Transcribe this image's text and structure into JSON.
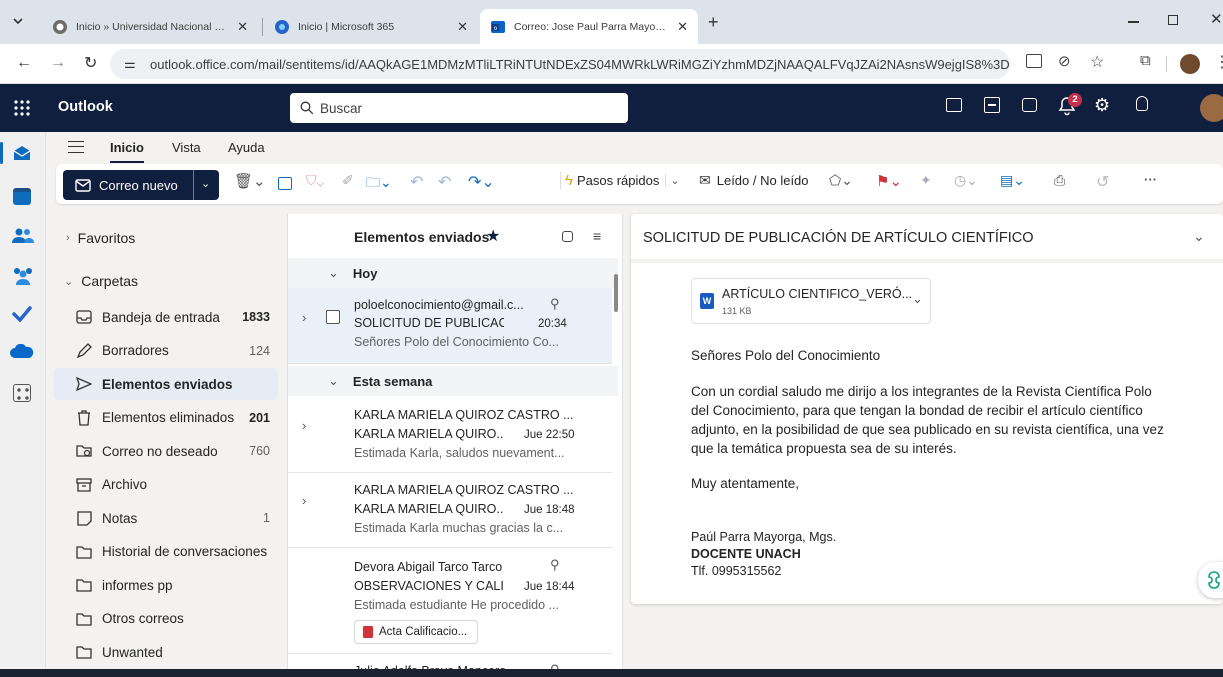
{
  "browser": {
    "tabs": [
      {
        "title": "Inicio » Universidad Nacional de Chimborazo"
      },
      {
        "title": "Inicio | Microsoft 365"
      },
      {
        "title": "Correo: Jose Paul Parra Mayorga - Outlook"
      }
    ],
    "url": "outlook.office.com/mail/sentitems/id/AAQkAGE1MDMzMTliLTRiNTUtNDExZS04MWRkLWRiMGZiYzhmMDZjNAAQALFVqJZAi2NAsnsW9ejgIS8%3D",
    "new_tab": "+"
  },
  "app": {
    "name": "Outlook",
    "search_placeholder": "Buscar",
    "notification_count": "2"
  },
  "ribbon": {
    "tabs": [
      "Inicio",
      "Vista",
      "Ayuda"
    ],
    "new_mail": "Correo nuevo",
    "quick_steps": "Pasos rápidos",
    "read_unread": "Leído / No leído",
    "more": "···"
  },
  "folders": {
    "favorites": "Favoritos",
    "folders_header": "Carpetas",
    "items": [
      {
        "label": "Bandeja de entrada",
        "count": "1833",
        "bold": true,
        "icon": "inbox-icon"
      },
      {
        "label": "Borradores",
        "count": "124",
        "bold": false,
        "icon": "drafts-icon"
      },
      {
        "label": "Elementos enviados",
        "count": "",
        "bold": false,
        "icon": "sent-icon"
      },
      {
        "label": "Elementos eliminados",
        "count": "201",
        "bold": true,
        "icon": "trash-icon"
      },
      {
        "label": "Correo no deseado",
        "count": "760",
        "bold": false,
        "icon": "junk-icon"
      },
      {
        "label": "Archivo",
        "count": "",
        "bold": false,
        "icon": "archive-icon"
      },
      {
        "label": "Notas",
        "count": "1",
        "bold": false,
        "icon": "notes-icon"
      },
      {
        "label": "Historial de conversaciones",
        "count": "",
        "bold": false,
        "icon": "folder-icon"
      },
      {
        "label": "informes pp",
        "count": "",
        "bold": false,
        "icon": "folder-icon"
      },
      {
        "label": "Otros correos",
        "count": "",
        "bold": false,
        "icon": "folder-icon"
      },
      {
        "label": "Unwanted",
        "count": "",
        "bold": false,
        "icon": "folder-icon"
      }
    ]
  },
  "message_list": {
    "title": "Elementos enviados",
    "groups": [
      "Hoy",
      "Esta semana"
    ],
    "messages": [
      {
        "from": "poloelconocimiento@gmail.c...",
        "subject": "SOLICITUD DE PUBLICACIÓ...",
        "time": "20:34",
        "preview": "Señores Polo del Conocimiento Co..."
      },
      {
        "from": "KARLA MARIELA QUIROZ CASTRO ...",
        "subject": "KARLA MARIELA QUIRO...",
        "time": "Jue 22:50",
        "preview": "Estimada Karla, saludos nuevament..."
      },
      {
        "from": "KARLA MARIELA QUIROZ CASTRO ...",
        "subject": "KARLA MARIELA QUIRO...",
        "time": "Jue 18:48",
        "preview": "Estimada Karla muchas gracias la c..."
      },
      {
        "from": "Devora Abigail Tarco Tarco",
        "subject": "OBSERVACIONES Y CALI...",
        "time": "Jue 18:44",
        "preview": "Estimada estudiante He procedido ...",
        "attachment": "Acta Calificacio..."
      },
      {
        "from": "Julio Adolfo Bravo Mancero"
      }
    ]
  },
  "reading": {
    "subject": "SOLICITUD DE PUBLICACIÓN DE ARTÍCULO CIENTÍFICO",
    "attachment_name": "ARTÍCULO CIENTIFICO_VERÓ...",
    "attachment_size": "131 KB",
    "greeting": "Señores Polo del Conocimiento",
    "body_lines": [
      "Con un cordial saludo me dirijo a los integrantes de la Revista Científica Polo",
      "del Conocimiento, para que tengan la bondad de recibir el artículo científico",
      "adjunto, en la posibilidad de que sea publicado en su revista científica, una vez",
      "que la temática propuesta sea de su interés."
    ],
    "closing": "Muy atentamente,",
    "signature_name": "Paúl Parra Mayorga, Mgs.",
    "signature_title": "DOCENTE UNACH",
    "signature_phone": "Tlf. 0995315562"
  },
  "colors": {
    "header": "#0f1f3d",
    "accent": "#0f6cbd",
    "selected": "#e6ecf4"
  }
}
